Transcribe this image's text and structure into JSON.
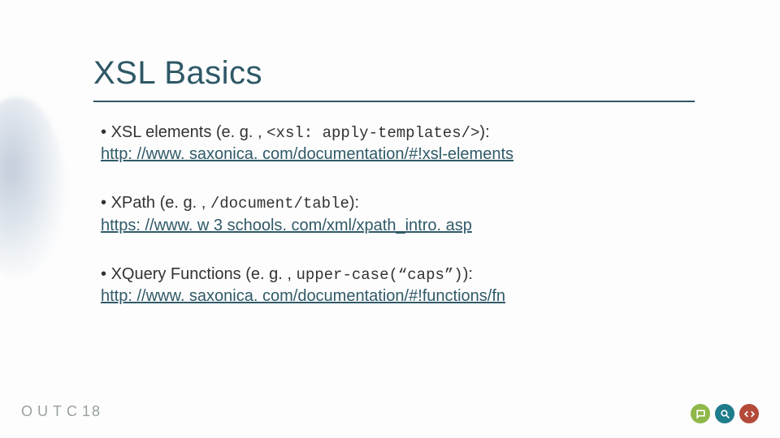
{
  "title": "XSL Basics",
  "bullets": [
    {
      "lead": "XSL elements",
      "eg_open": " (e. g. , ",
      "code": "<xsl: apply-templates/>",
      "eg_close": "): ",
      "link": "http: //www. saxonica. com/documentation/#!xsl-elements"
    },
    {
      "lead": "XPath",
      "eg_open": " (e. g. , ",
      "code": "/document/table",
      "eg_close": "): ",
      "link": "https: //www. w 3 schools. com/xml/xpath_intro. asp"
    },
    {
      "lead": "XQuery Functions",
      "eg_open": " (e. g. , ",
      "code": "upper-case(“caps”)",
      "eg_close": "): ",
      "link": "http: //www. saxonica. com/documentation/#!functions/fn"
    }
  ],
  "footer": {
    "brand": "OUTC",
    "year": "18"
  },
  "icons": {
    "chat": "chat-icon",
    "search": "search-icon",
    "code": "code-icon"
  }
}
